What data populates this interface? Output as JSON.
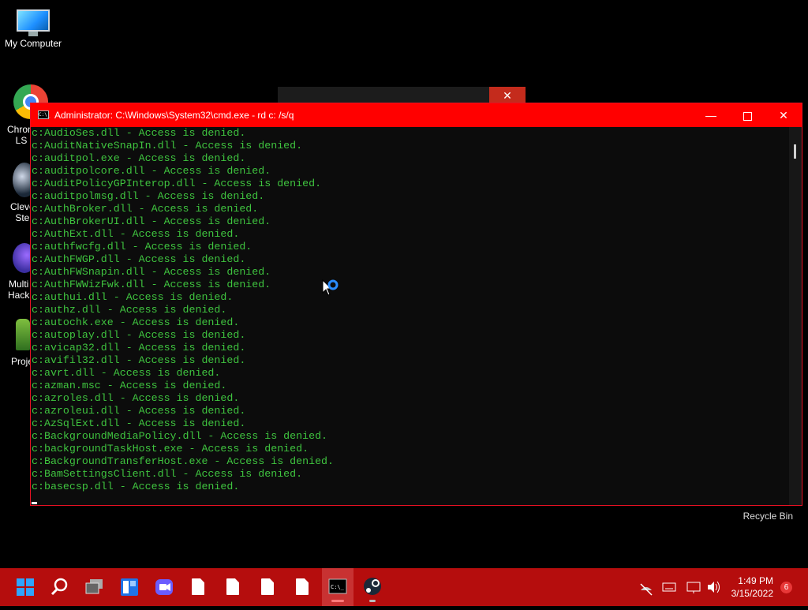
{
  "desktop": {
    "icons": [
      {
        "label": "My Computer"
      },
      {
        "label": "Chrom\nLS"
      },
      {
        "label": "Cleve\nSte"
      },
      {
        "label": "Multi\nHack"
      },
      {
        "label": "Proje"
      }
    ],
    "recycle_bin": "Recycle Bin"
  },
  "background_dialog": {
    "close_glyph": "✕"
  },
  "cmd_window": {
    "title": "Administrator: C:\\Windows\\System32\\cmd.exe - rd  c: /s/q",
    "icon_text": "C:\\_",
    "controls": {
      "minimize": "—",
      "maximize": "☐",
      "close": "✕"
    },
    "lines": [
      "c:AudioSes.dll - Access is denied.",
      "c:AuditNativeSnapIn.dll - Access is denied.",
      "c:auditpol.exe - Access is denied.",
      "c:auditpolcore.dll - Access is denied.",
      "c:AuditPolicyGPInterop.dll - Access is denied.",
      "c:auditpolmsg.dll - Access is denied.",
      "c:AuthBroker.dll - Access is denied.",
      "c:AuthBrokerUI.dll - Access is denied.",
      "c:AuthExt.dll - Access is denied.",
      "c:authfwcfg.dll - Access is denied.",
      "c:AuthFWGP.dll - Access is denied.",
      "c:AuthFWSnapin.dll - Access is denied.",
      "c:AuthFWWizFwk.dll - Access is denied.",
      "c:authui.dll - Access is denied.",
      "c:authz.dll - Access is denied.",
      "c:autochk.exe - Access is denied.",
      "c:autoplay.dll - Access is denied.",
      "c:avicap32.dll - Access is denied.",
      "c:avifil32.dll - Access is denied.",
      "c:avrt.dll - Access is denied.",
      "c:azman.msc - Access is denied.",
      "c:azroles.dll - Access is denied.",
      "c:azroleui.dll - Access is denied.",
      "c:AzSqlExt.dll - Access is denied.",
      "c:BackgroundMediaPolicy.dll - Access is denied.",
      "c:backgroundTaskHost.exe - Access is denied.",
      "c:BackgroundTransferHost.exe - Access is denied.",
      "c:BamSettingsClient.dll - Access is denied.",
      "c:basecsp.dll - Access is denied."
    ]
  },
  "taskbar": {
    "apps": [
      "start-icon",
      "search-icon",
      "task-view-icon",
      "widgets-icon",
      "chat-icon",
      "file-icon",
      "file-icon",
      "file-icon",
      "file-icon",
      "cmd-icon",
      "steam-icon"
    ],
    "clock": {
      "time": "1:49 PM",
      "date": "3/15/2022"
    },
    "notification_count": "6"
  },
  "colors": {
    "console_text": "#3fc43f",
    "titlebar": "#ff0000",
    "taskbar": "#b50d0d"
  }
}
